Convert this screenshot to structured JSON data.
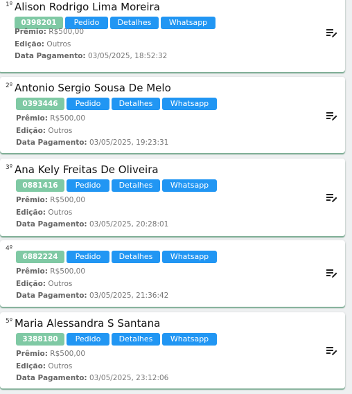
{
  "labels": {
    "premio": "Prêmio:",
    "edicao": "Edição:",
    "data_pagamento": "Data Pagamento:",
    "pedido": "Pedido",
    "detalhes": "Detalhes",
    "whatsapp": "Whatsapp"
  },
  "colors": {
    "code_badge": "#7fc9a4",
    "button": "#2196f3",
    "card_shadow": "#7fae96"
  },
  "icons": {
    "card_action": "playlist-edit-icon"
  },
  "winners": [
    {
      "rank": "1º",
      "name": "Alison Rodrigo Lima Moreira",
      "code": "0398201",
      "premio": "R$500,00",
      "edicao": "Outros",
      "data_pagamento": "03/05/2025, 18:52:32"
    },
    {
      "rank": "2º",
      "name": "Antonio Sergio Sousa De Melo",
      "code": "0393446",
      "premio": "R$500,00",
      "edicao": "Outros",
      "data_pagamento": "03/05/2025, 19:23:31"
    },
    {
      "rank": "3º",
      "name": "Ana Kely Freitas De Oliveira",
      "code": "0881416",
      "premio": "R$500,00",
      "edicao": "Outros",
      "data_pagamento": "03/05/2025, 20:28:01"
    },
    {
      "rank": "4º",
      "name": "",
      "code": "6882224",
      "premio": "R$500,00",
      "edicao": "Outros",
      "data_pagamento": "03/05/2025, 21:36:42"
    },
    {
      "rank": "5º",
      "name": "Maria Alessandra S Santana",
      "code": "3388180",
      "premio": "R$500,00",
      "edicao": "Outros",
      "data_pagamento": "03/05/2025, 23:12:06"
    }
  ]
}
